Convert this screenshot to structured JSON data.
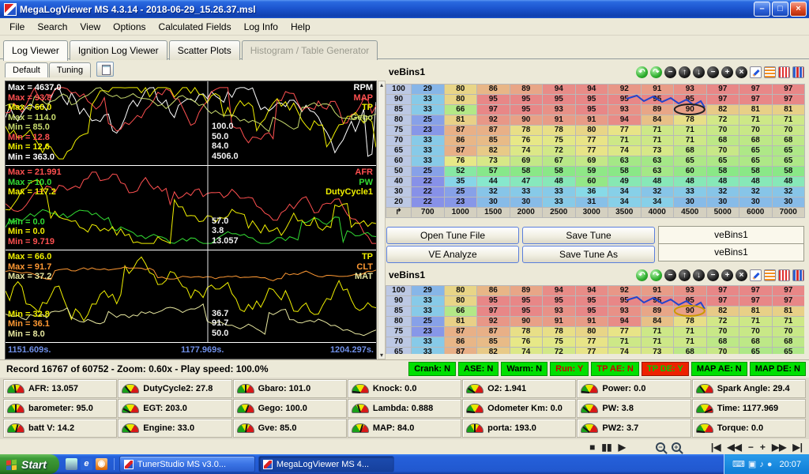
{
  "titlebar": {
    "title": "MegaLogViewer MS 4.3.14 - 2018-06-29_15.26.37.msl",
    "controls": {
      "minimize": "–",
      "maximize": "□",
      "close": "×"
    }
  },
  "menu": {
    "items": [
      "File",
      "Search",
      "View",
      "Options",
      "Calculated Fields",
      "Log Info",
      "Help"
    ]
  },
  "main_tabs": {
    "items": [
      {
        "label": "Log Viewer",
        "state": "active"
      },
      {
        "label": "Ignition Log Viewer",
        "state": "normal"
      },
      {
        "label": "Scatter Plots",
        "state": "normal"
      },
      {
        "label": "Histogram / Table Generator",
        "state": "disabled"
      }
    ]
  },
  "view_tabs": {
    "items": [
      {
        "label": "Default",
        "state": "active"
      },
      {
        "label": "Tuning",
        "state": "normal"
      }
    ]
  },
  "graph_scrollbar": {
    "up": "▴",
    "down": "▾"
  },
  "graph": {
    "cursor_frac": 0.545,
    "time_labels": [
      "1151.609s.",
      "1177.969s.",
      "1204.297s."
    ],
    "panels": [
      {
        "max_labels": [
          {
            "text": "Max = 4637.0",
            "color": "#ffffff"
          },
          {
            "text": "Max = 93.8",
            "color": "#ff5050"
          },
          {
            "text": "Max = 66.0",
            "color": "#f0f000"
          },
          {
            "text": "Max = 114.0",
            "color": "#c9dc6e"
          }
        ],
        "min_labels": [
          {
            "text": "Min = 85.0",
            "color": "#c9dc6e"
          },
          {
            "text": "Min = 12.8",
            "color": "#ff5050"
          },
          {
            "text": "Min = 12.6",
            "color": "#f0f000"
          },
          {
            "text": "Min = 363.0",
            "color": "#ffffff"
          }
        ],
        "legend": [
          {
            "text": "RPM",
            "color": "#ffffff"
          },
          {
            "text": "MAP",
            "color": "#ff5050"
          },
          {
            "text": "TP",
            "color": "#f0f000"
          },
          {
            "text": "Gego",
            "color": "#c9dc6e"
          }
        ],
        "cursor_values": [
          "100.0",
          "50.0",
          "84.0",
          "4506.0"
        ],
        "traces": [
          {
            "color": "#ffffff",
            "base": 0.5,
            "amp": 0.42,
            "seed": 11
          },
          {
            "color": "#ff5050",
            "base": 0.42,
            "amp": 0.3,
            "seed": 22
          },
          {
            "color": "#f0f000",
            "base": 0.6,
            "amp": 0.33,
            "seed": 33
          },
          {
            "color": "#c9dc6e",
            "base": 0.3,
            "amp": 0.14,
            "seed": 44
          }
        ]
      },
      {
        "max_labels": [
          {
            "text": "Max = 21.991",
            "color": "#ff5050"
          },
          {
            "text": "Max = 10.0",
            "color": "#33dd33"
          },
          {
            "text": "Max = 117.2",
            "color": "#f0f000"
          }
        ],
        "min_labels": [
          {
            "text": "Min = 0.0",
            "color": "#33dd33"
          },
          {
            "text": "Min = 0.0",
            "color": "#f0f000"
          },
          {
            "text": "Min = 9.719",
            "color": "#ff5050"
          }
        ],
        "legend": [
          {
            "text": "AFR",
            "color": "#ff5050"
          },
          {
            "text": "PW",
            "color": "#33dd33"
          },
          {
            "text": "DutyCycle1",
            "color": "#f0f000"
          }
        ],
        "cursor_values": [
          "57.0",
          "3.8",
          "13.057"
        ],
        "traces": [
          {
            "color": "#ff5050",
            "base": 0.5,
            "amp": 0.28,
            "seed": 55
          },
          {
            "color": "#33dd33",
            "base": 0.78,
            "amp": 0.14,
            "seed": 66
          },
          {
            "color": "#f0f000",
            "base": 0.58,
            "amp": 0.3,
            "seed": 77
          }
        ]
      },
      {
        "max_labels": [
          {
            "text": "Max = 66.0",
            "color": "#f0f000"
          },
          {
            "text": "Max = 91.7",
            "color": "#ff9933"
          },
          {
            "text": "Max = 37.2",
            "color": "#e8e8a0"
          }
        ],
        "min_labels": [
          {
            "text": "Min = 32.8",
            "color": "#f0f000"
          },
          {
            "text": "Min = 36.1",
            "color": "#ff9933"
          },
          {
            "text": "Min = 8.0",
            "color": "#e8e8a0"
          }
        ],
        "legend": [
          {
            "text": "TP",
            "color": "#f0f000"
          },
          {
            "text": "CLT",
            "color": "#ff9933"
          },
          {
            "text": "MAT",
            "color": "#e8e8a0"
          }
        ],
        "cursor_values": [
          "36.7",
          "91.7",
          "50.0"
        ],
        "traces": [
          {
            "color": "#f0f000",
            "base": 0.5,
            "amp": 0.33,
            "seed": 88
          },
          {
            "color": "#ff9933",
            "base": 0.22,
            "amp": 0.06,
            "seed": 99
          },
          {
            "color": "#e8e8a0",
            "base": 0.72,
            "amp": 0.09,
            "seed": 111
          }
        ]
      }
    ]
  },
  "ve_table": {
    "title": "veBins1",
    "corner_glyph": "↱",
    "rpm_cols": [
      "700",
      "1000",
      "1500",
      "2000",
      "2500",
      "3000",
      "3500",
      "4000",
      "4500",
      "5000",
      "6000",
      "7000"
    ],
    "map_rows": [
      "100",
      "90",
      "85",
      "80",
      "75",
      "70",
      "65",
      "60",
      "50",
      "40",
      "30",
      "20"
    ],
    "values": [
      [
        29,
        80,
        86,
        89,
        94,
        94,
        92,
        91,
        93,
        97,
        97,
        97
      ],
      [
        33,
        80,
        95,
        95,
        95,
        95,
        95,
        95,
        95,
        97,
        97,
        97
      ],
      [
        33,
        66,
        97,
        95,
        93,
        95,
        93,
        89,
        90,
        82,
        81,
        81
      ],
      [
        25,
        81,
        92,
        90,
        91,
        91,
        94,
        84,
        78,
        72,
        71,
        71
      ],
      [
        23,
        87,
        87,
        78,
        78,
        80,
        77,
        71,
        71,
        70,
        70,
        70
      ],
      [
        33,
        86,
        85,
        76,
        75,
        77,
        71,
        71,
        71,
        68,
        68,
        68
      ],
      [
        33,
        87,
        82,
        74,
        72,
        77,
        74,
        73,
        68,
        70,
        65,
        65
      ],
      [
        33,
        76,
        73,
        69,
        67,
        69,
        63,
        63,
        65,
        65,
        65,
        65
      ],
      [
        25,
        52,
        57,
        58,
        58,
        59,
        58,
        63,
        60,
        58,
        58,
        58
      ],
      [
        22,
        35,
        44,
        47,
        48,
        60,
        49,
        48,
        48,
        48,
        48,
        48
      ],
      [
        22,
        25,
        32,
        33,
        33,
        36,
        34,
        32,
        33,
        32,
        32,
        32
      ],
      [
        22,
        23,
        30,
        30,
        33,
        31,
        34,
        34,
        30,
        30,
        30,
        30
      ]
    ]
  },
  "ve_toolbar": {
    "icons": [
      {
        "name": "undo-icon",
        "glyph": "↶",
        "type": "green"
      },
      {
        "name": "redo-icon",
        "glyph": "↷",
        "type": "green"
      },
      {
        "name": "decrease-cell-icon",
        "glyph": "−",
        "type": "black"
      },
      {
        "name": "shift-up-icon",
        "glyph": "↑",
        "type": "black"
      },
      {
        "name": "shift-down-icon",
        "glyph": "↓",
        "type": "black"
      },
      {
        "name": "scale-down-icon",
        "glyph": "−",
        "type": "black"
      },
      {
        "name": "scale-up-icon",
        "glyph": "+",
        "type": "black"
      },
      {
        "name": "clear-selection-icon",
        "glyph": "×",
        "type": "black"
      },
      {
        "name": "edit-pencil-icon",
        "glyph": "",
        "type": "pencil"
      },
      {
        "name": "table-stripes-icon",
        "glyph": "",
        "type": "so"
      },
      {
        "name": "table-columns-icon",
        "glyph": "",
        "type": "sr"
      },
      {
        "name": "table-chart-icon",
        "glyph": "",
        "type": "bb"
      }
    ]
  },
  "tune_buttons": {
    "open": "Open Tune File",
    "save": "Save Tune",
    "analyze": "VE Analyze",
    "save_as": "Save Tune As"
  },
  "table_list": {
    "items": [
      "veBins1",
      "veBins1"
    ]
  },
  "record_bar": {
    "text": "Record 16767 of 60752 - Zoom: 0.60x - Play speed: 100.0%"
  },
  "flags": {
    "items": [
      {
        "label": "Crank: N",
        "bg": "#00e000",
        "fg": "#000000"
      },
      {
        "label": "ASE: N",
        "bg": "#00e000",
        "fg": "#000000"
      },
      {
        "label": "Warm: N",
        "bg": "#00e000",
        "fg": "#000000"
      },
      {
        "label": "Run: Y",
        "bg": "#00e000",
        "fg": "#cc0000"
      },
      {
        "label": "TP AE: N",
        "bg": "#00e000",
        "fg": "#cc0000"
      },
      {
        "label": "TP DE: Y",
        "bg": "#ee2200",
        "fg": "#00cc00"
      },
      {
        "label": "MAP AE: N",
        "bg": "#00e000",
        "fg": "#000000"
      },
      {
        "label": "MAP DE: N",
        "bg": "#00e000",
        "fg": "#000000"
      }
    ]
  },
  "gauges": {
    "items": [
      {
        "label": "AFR",
        "value": "13.057",
        "needle": 0.45
      },
      {
        "label": "DutyCycle2",
        "value": "27.8",
        "needle": 0.28
      },
      {
        "label": "Gbaro",
        "value": "101.0",
        "needle": 0.5
      },
      {
        "label": "Knock",
        "value": "0.0",
        "needle": 0.04
      },
      {
        "label": "O2",
        "value": "1.941",
        "needle": 0.18
      },
      {
        "label": "Power",
        "value": "0.0",
        "needle": 0.04
      },
      {
        "label": "Spark Angle",
        "value": "29.4",
        "needle": 0.3
      },
      {
        "label": "barometer",
        "value": "95.0",
        "needle": 0.5
      },
      {
        "label": "EGT",
        "value": "203.0",
        "needle": 0.15
      },
      {
        "label": "Gego",
        "value": "100.0",
        "needle": 0.62
      },
      {
        "label": "Lambda",
        "value": "0.888",
        "needle": 0.4
      },
      {
        "label": "Odometer Km",
        "value": "0.0",
        "needle": 0.04
      },
      {
        "label": "PW",
        "value": "3.8",
        "needle": 0.22
      },
      {
        "label": "Time",
        "value": "1177.969",
        "needle": 0.88
      },
      {
        "label": "batt V",
        "value": "14.2",
        "needle": 0.58
      },
      {
        "label": "Engine",
        "value": "33.0",
        "needle": 0.25
      },
      {
        "label": "Gve",
        "value": "85.0",
        "needle": 0.55
      },
      {
        "label": "MAP",
        "value": "84.0",
        "needle": 0.6
      },
      {
        "label": "porta",
        "value": "193.0",
        "needle": 0.5
      },
      {
        "label": "PW2",
        "value": "3.7",
        "needle": 0.22
      },
      {
        "label": "Torque",
        "value": "0.0",
        "needle": 0.04
      }
    ]
  },
  "playback": {
    "buttons": [
      {
        "name": "stop-button",
        "glyph": "■",
        "group": 1
      },
      {
        "name": "pause-button",
        "glyph": "▮▮",
        "group": 1
      },
      {
        "name": "play-button",
        "glyph": "▶",
        "group": 1
      },
      {
        "name": "zoom-out-button",
        "glyph": "−",
        "group": 2,
        "mag": true
      },
      {
        "name": "zoom-in-button",
        "glyph": "+",
        "group": 2,
        "mag": true
      },
      {
        "name": "go-first-button",
        "glyph": "|◀",
        "group": 3
      },
      {
        "name": "fast-back-button",
        "glyph": "◀◀",
        "group": 3
      },
      {
        "name": "step-minus-button",
        "glyph": "−",
        "group": 3
      },
      {
        "name": "step-plus-button",
        "glyph": "+",
        "group": 3
      },
      {
        "name": "fast-forward-button",
        "glyph": "▶▶",
        "group": 3
      },
      {
        "name": "go-last-button",
        "glyph": "▶|",
        "group": 3
      }
    ]
  },
  "taskbar": {
    "start_label": "Start",
    "clock": "20:07",
    "tasks": [
      {
        "label": "TunerStudio MS v3.0...",
        "active": false
      },
      {
        "label": "MegaLogViewer MS 4...",
        "active": true
      }
    ],
    "quick_launch": [
      {
        "name": "show-desktop-icon",
        "glyph": "",
        "cls": "d"
      },
      {
        "name": "internet-explorer-icon",
        "glyph": "e",
        "cls": "e"
      },
      {
        "name": "media-player-icon",
        "glyph": "◉",
        "cls": "m"
      }
    ],
    "tray_icons": [
      {
        "name": "tray-keyboard-icon",
        "glyph": "⌨"
      },
      {
        "name": "tray-display-icon",
        "glyph": "▣"
      },
      {
        "name": "tray-volume-icon",
        "glyph": "♪"
      },
      {
        "name": "tray-network-icon",
        "glyph": "●"
      }
    ]
  }
}
